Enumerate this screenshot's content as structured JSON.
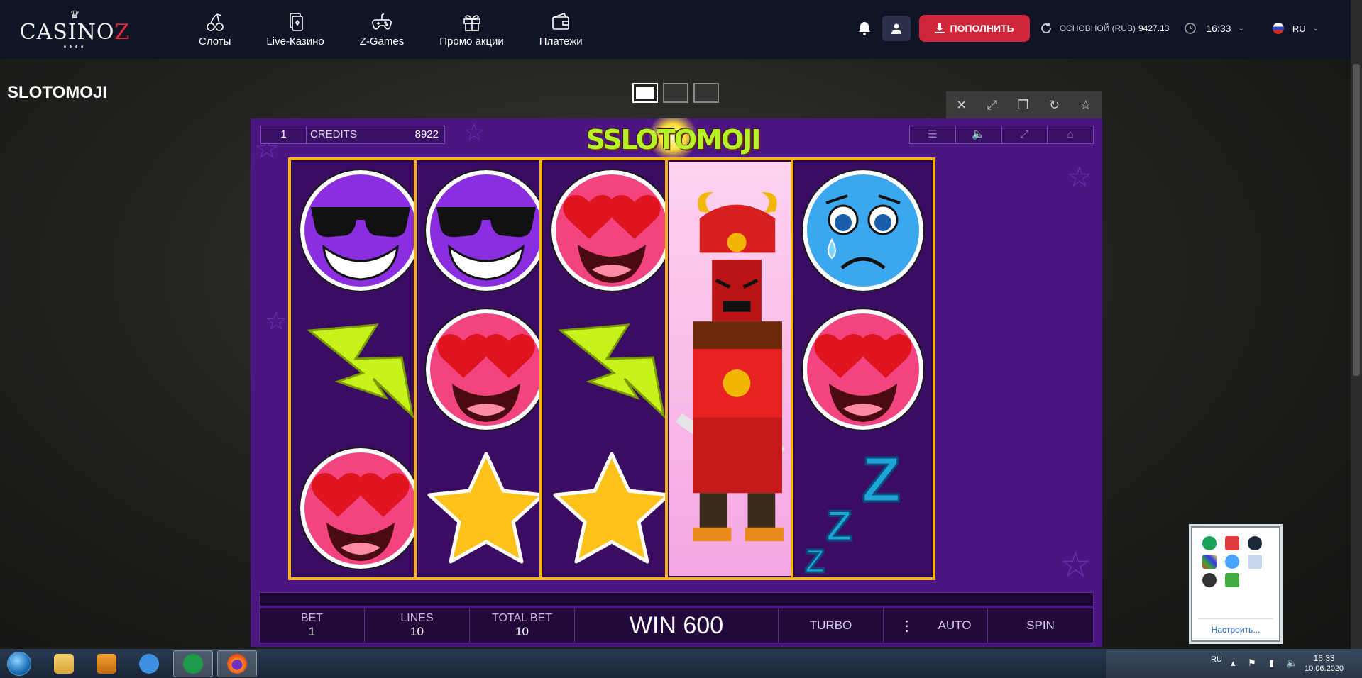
{
  "site": {
    "logo_text": "CASINO",
    "logo_letter": "Z",
    "nav": [
      {
        "label": "Слоты",
        "icon": "cherry-icon"
      },
      {
        "label": "Live-Казино",
        "icon": "cards-icon"
      },
      {
        "label": "Z-Games",
        "icon": "gamepad-icon"
      },
      {
        "label": "Промо акции",
        "icon": "gift-icon"
      },
      {
        "label": "Платежи",
        "icon": "wallet-icon"
      }
    ],
    "deposit_label": "ПОПОЛНИТЬ",
    "balance_label": "ОСНОВНОЙ (RUB)",
    "balance_value": "9427.13",
    "time": "16:33",
    "language": "RU"
  },
  "page": {
    "title": "SLOTOMOJI"
  },
  "game": {
    "line_value": "1",
    "credits_label": "CREDITS",
    "credits_value": "8922",
    "logo_text": "SSLOTOMOJI",
    "reels": [
      [
        "cool-emoji",
        "lightning",
        "love-emoji"
      ],
      [
        "cool-emoji",
        "love-emoji",
        "star"
      ],
      [
        "love-emoji",
        "lightning",
        "star"
      ],
      [
        "samurai"
      ],
      [
        "sad-emoji",
        "love-emoji",
        "zzz"
      ]
    ],
    "bet_label": "BET",
    "bet_value": "1",
    "lines_label": "LINES",
    "lines_value": "10",
    "total_bet_label": "TOTAL BET",
    "total_bet_value": "10",
    "win_text": "WIN 600",
    "turbo_label": "TURBO",
    "auto_label": "AUTO",
    "spin_label": "SPIN"
  },
  "tray_popup": {
    "customize_link": "Настроить..."
  },
  "taskbar": {
    "lang": "RU",
    "time": "16:33",
    "date": "10.06.2020"
  },
  "colors": {
    "topbar": "#0f1526",
    "deposit": "#d12639",
    "game_bg": "#4b1582",
    "reel_border": "#f5b21f"
  }
}
